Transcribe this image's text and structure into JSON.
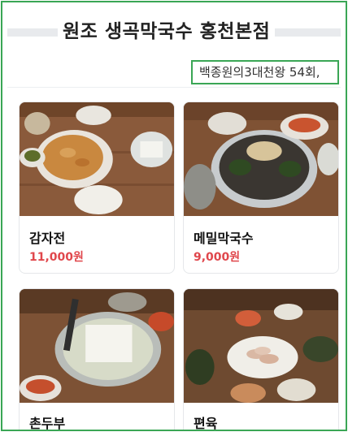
{
  "page": {
    "title": "원조 생곡막국수 홍천본점",
    "tag": "백종원의3대천왕 54회,"
  },
  "menu": [
    {
      "name": "감자전",
      "price": "11,000원",
      "photo": "potato-pancake-photo"
    },
    {
      "name": "메밀막국수",
      "price": "9,000원",
      "photo": "buckwheat-noodles-photo"
    },
    {
      "name": "촌두부",
      "price": "",
      "photo": "tofu-photo"
    },
    {
      "name": "편육",
      "price": "",
      "photo": "boiled-pork-photo"
    }
  ],
  "colors": {
    "accent_border": "#3aa655",
    "price": "#e0474c",
    "table_wood": "#8a5a3b"
  }
}
